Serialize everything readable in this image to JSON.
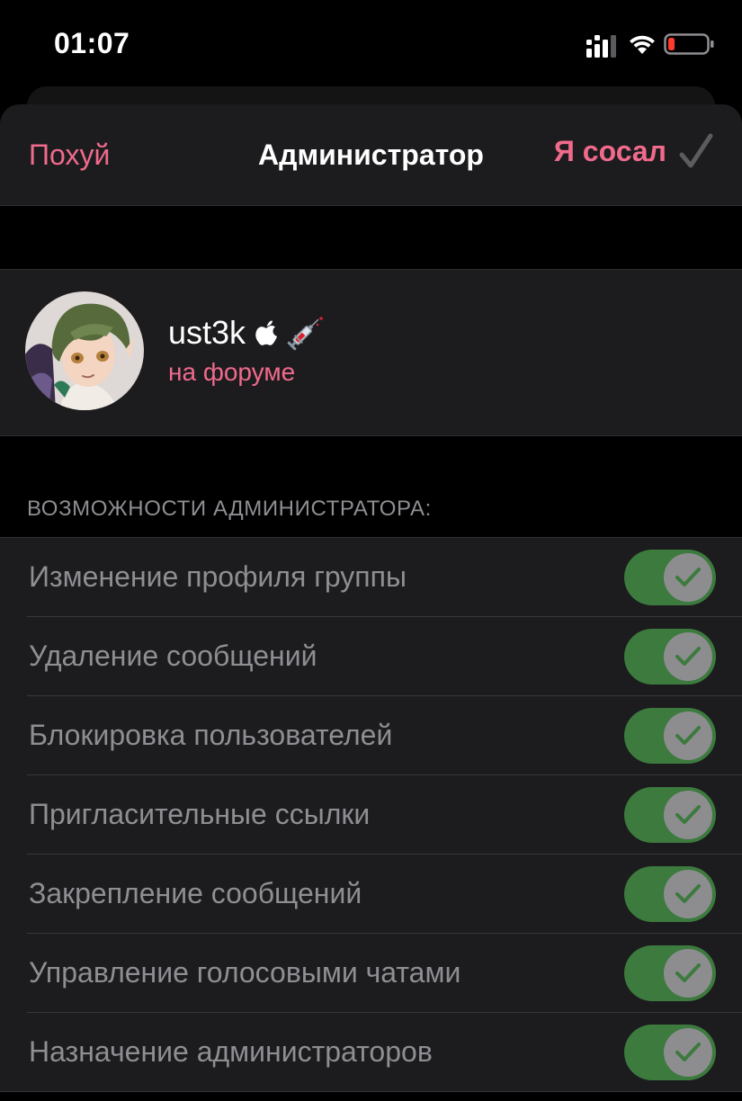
{
  "status_bar": {
    "time": "01:07"
  },
  "nav": {
    "cancel_label": "Похуй",
    "title": "Администратор",
    "done_label": "Я сосал"
  },
  "user": {
    "name": "ust3k",
    "status": "на форуме",
    "badges": [
      "apple-icon",
      "syringe-icon"
    ]
  },
  "section_header": "ВОЗМОЖНОСТИ АДМИНИСТРАТОРА:",
  "rights": [
    {
      "label": "Изменение профиля группы",
      "enabled": true
    },
    {
      "label": "Удаление сообщений",
      "enabled": true
    },
    {
      "label": "Блокировка пользователей",
      "enabled": true
    },
    {
      "label": "Пригласительные ссылки",
      "enabled": true
    },
    {
      "label": "Закрепление сообщений",
      "enabled": true
    },
    {
      "label": "Управление голосовыми чатами",
      "enabled": true
    },
    {
      "label": "Назначение администраторов",
      "enabled": true
    }
  ],
  "colors": {
    "accent": "#f06a8c",
    "toggle_on": "#3c7a3e",
    "toggle_check": "#3c7a3e",
    "background": "#000000",
    "cell_background": "#1c1c1e",
    "secondary_text": "#8e8e93",
    "battery_low": "#ff3b30"
  }
}
